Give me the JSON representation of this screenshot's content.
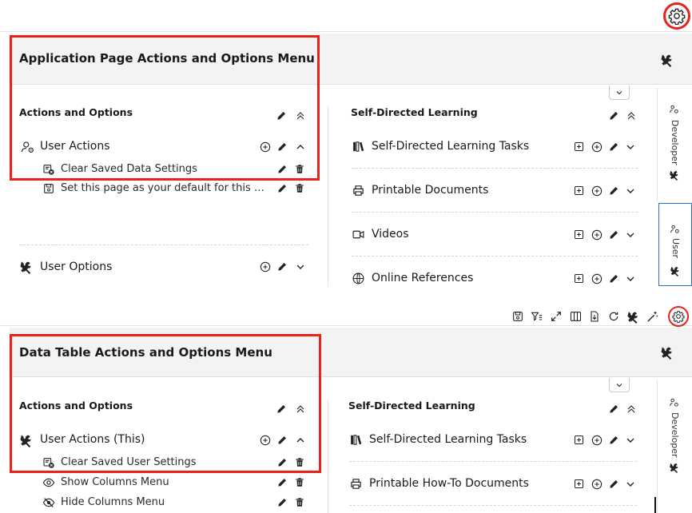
{
  "app": {
    "top_panel": {
      "title": "Application Page Actions and Options Menu",
      "left_column": {
        "title": "Actions and Options",
        "rows": [
          {
            "label": "User Actions",
            "icon": "user-gear-icon"
          },
          {
            "label": "Clear Saved Data Settings",
            "icon": "clear-settings-icon"
          },
          {
            "label": "Set this page as your default for this r...",
            "icon": "save-icon"
          },
          {
            "label": "User Options",
            "icon": "tools-icon"
          }
        ]
      },
      "right_column": {
        "title": "Self-Directed Learning",
        "rows": [
          {
            "label": "Self-Directed Learning Tasks",
            "icon": "books-icon"
          },
          {
            "label": "Printable Documents",
            "icon": "printer-icon"
          },
          {
            "label": "Videos",
            "icon": "video-icon"
          },
          {
            "label": "Online References",
            "icon": "globe-icon"
          }
        ]
      },
      "side_tabs": [
        {
          "label": "Developer"
        },
        {
          "label": "User"
        }
      ]
    },
    "bottom_panel": {
      "title": "Data Table Actions and Options Menu",
      "left_column": {
        "title": "Actions and Options",
        "rows": [
          {
            "label": "User Actions (This)",
            "icon": "tools-icon"
          },
          {
            "label": "Clear Saved User Settings",
            "icon": "clear-settings-icon"
          },
          {
            "label": "Show Columns Menu",
            "icon": "eye-icon"
          },
          {
            "label": "Hide Columns Menu",
            "icon": "eye-off-icon"
          }
        ]
      },
      "right_column": {
        "title": "Self-Directed Learning",
        "rows": [
          {
            "label": "Self-Directed Learning Tasks",
            "icon": "books-icon"
          },
          {
            "label": "Printable How-To Documents",
            "icon": "printer-icon"
          }
        ]
      },
      "side_tabs": [
        {
          "label": "Developer"
        }
      ]
    },
    "colors": {
      "highlight": "#e8231a",
      "active_tab": "#2c6fcf",
      "header_bg": "#f3f3f3"
    }
  }
}
